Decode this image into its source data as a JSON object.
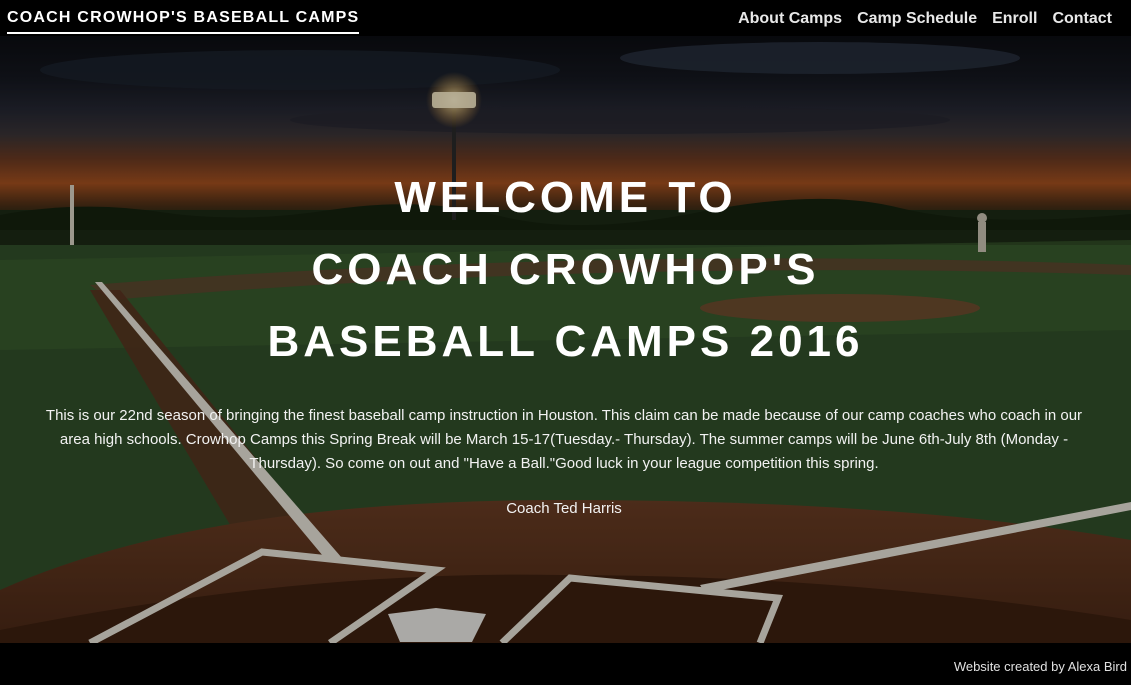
{
  "header": {
    "brand": "COACH CROWHOP'S BASEBALL CAMPS",
    "nav": [
      {
        "label": "About Camps"
      },
      {
        "label": "Camp Schedule"
      },
      {
        "label": "Enroll"
      },
      {
        "label": "Contact"
      }
    ]
  },
  "hero": {
    "headline_lines": [
      "WELCOME TO",
      "COACH CROWHOP'S",
      "BASEBALL CAMPS 2016"
    ],
    "intro": "This is our 22nd season of bringing the finest baseball camp instruction in Houston. This claim can be made because of our camp coaches who coach in our area high schools. Crowhop Camps this Spring Break will be March 15-17(Tuesday.- Thursday). The summer camps will be June 6th-July 8th (Monday - Thursday). So come on out and \"Have a Ball.\"Good luck in your league competition this spring.",
    "signature": "Coach Ted Harris"
  },
  "footer": {
    "credit": "Website created by Alexa Bird"
  }
}
